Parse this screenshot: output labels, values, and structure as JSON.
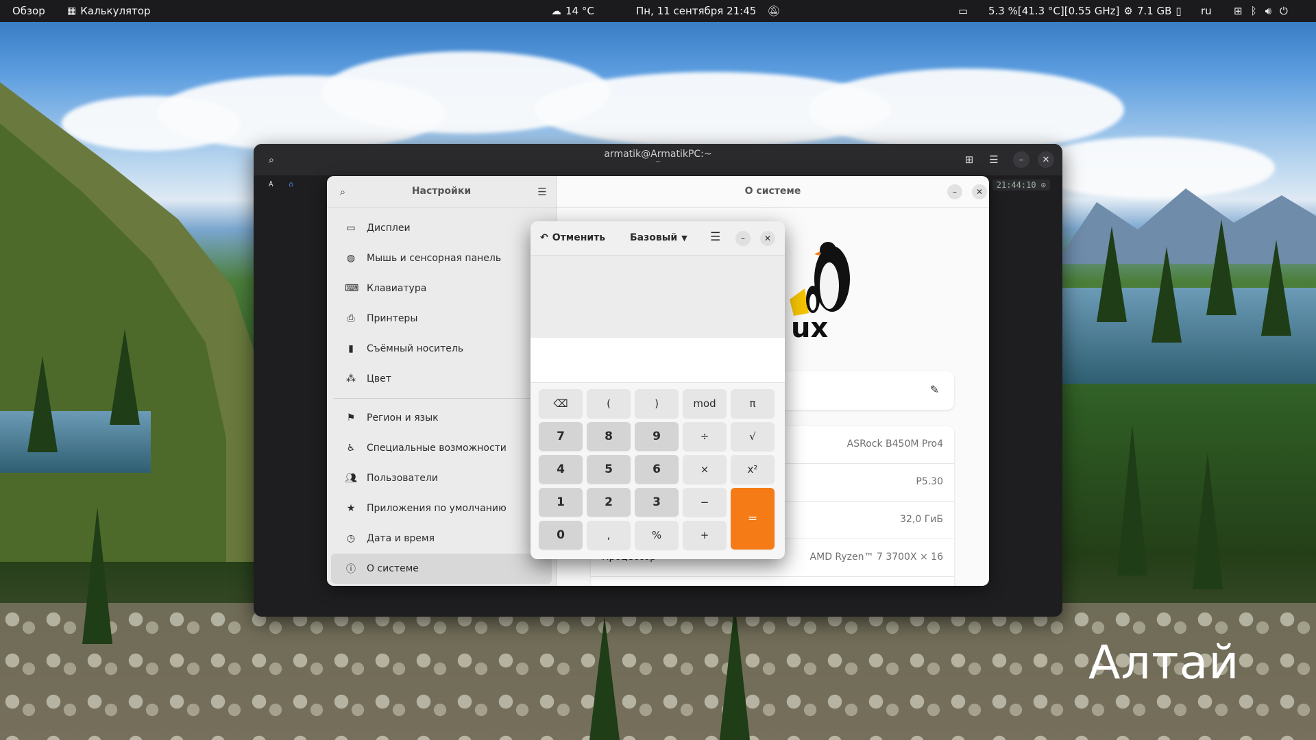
{
  "topbar": {
    "overview": "Обзор",
    "app_name": "Калькулятор",
    "weather": "14 °C",
    "datetime": "Пн, 11 сентября  21:45",
    "cpu": "5.3 %[41.3 °C][0.55 GHz]",
    "memory": "7.1 GB",
    "keyboard_layout": "ru"
  },
  "terminal": {
    "title": "armatik@ArmatikPC:~",
    "subtitle": "~",
    "prompt_user": "A",
    "clock": "21:44:10 ⊙"
  },
  "settings": {
    "sidebar_title": "Настройки",
    "items": [
      {
        "label": "Дисплеи",
        "icon": "display-icon"
      },
      {
        "label": "Мышь и сенсорная панель",
        "icon": "mouse-icon"
      },
      {
        "label": "Клавиатура",
        "icon": "keyboard-icon"
      },
      {
        "label": "Принтеры",
        "icon": "printer-icon"
      },
      {
        "label": "Съёмный носитель",
        "icon": "usb-icon"
      },
      {
        "label": "Цвет",
        "icon": "color-icon"
      },
      {
        "label": "Регион и язык",
        "icon": "flag-icon"
      },
      {
        "label": "Специальные возможности",
        "icon": "accessibility-icon"
      },
      {
        "label": "Пользователи",
        "icon": "users-icon"
      },
      {
        "label": "Приложения по умолчанию",
        "icon": "star-icon"
      },
      {
        "label": "Дата и время",
        "icon": "clock-icon"
      },
      {
        "label": "О системе",
        "icon": "info-icon"
      }
    ],
    "main_title": "О системе",
    "logo_text": "ux",
    "info_rows": [
      {
        "label": "",
        "value": "ASRock B450M Pro4"
      },
      {
        "label": "",
        "value": "P5.30"
      },
      {
        "label": "",
        "value": "32,0 ГиБ"
      },
      {
        "label": "Процессор",
        "value": "AMD Ryzen™ 7 3700X × 16"
      }
    ]
  },
  "calculator": {
    "undo_label": "Отменить",
    "mode_label": "Базовый",
    "keys": [
      "⌫",
      "(",
      ")",
      "mod",
      "π",
      "7",
      "8",
      "9",
      "÷",
      "√",
      "4",
      "5",
      "6",
      "×",
      "x²",
      "1",
      "2",
      "3",
      "−",
      "=",
      "0",
      ",",
      "%",
      "+"
    ]
  },
  "desktop": {
    "watermark": "Алтай"
  },
  "colors": {
    "accent": "#f47b15",
    "topbar": "#1b1b1d"
  }
}
